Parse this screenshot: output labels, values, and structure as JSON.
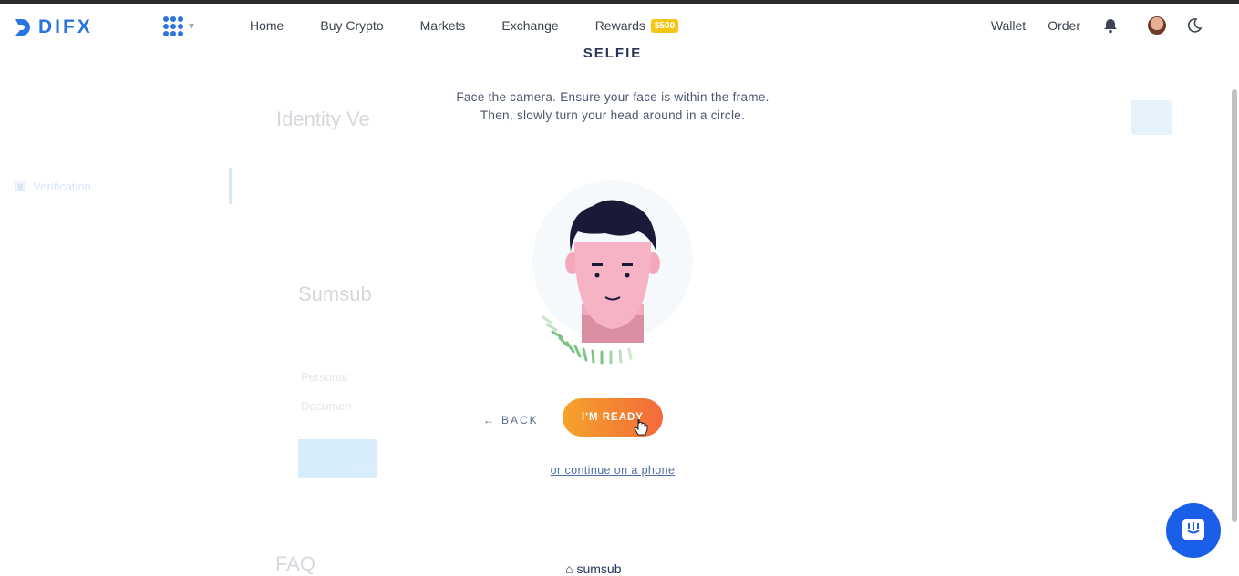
{
  "brand": {
    "name": "DIFX",
    "accent": "#2a74e0"
  },
  "nav": {
    "links": [
      "Home",
      "Buy Crypto",
      "Markets",
      "Exchange",
      "Rewards"
    ],
    "rewards_badge": "$500",
    "wallet": "Wallet",
    "order": "Order"
  },
  "background": {
    "title": "Identity Ve",
    "sidebar_item": "Verification",
    "provider": "Sumsub",
    "row1": "Personal",
    "row2": "Documen",
    "faq": "FAQ"
  },
  "modal": {
    "title": "SELFIE",
    "instruction_line1": "Face the camera. Ensure your face is within the frame.",
    "instruction_line2": "Then, slowly turn your head around in a circle.",
    "back_label": "BACK",
    "ready_label": "I'M READY",
    "phone_link": "or continue on a phone",
    "powered_by": "sumsub"
  },
  "icons": [
    "apps-grid-icon",
    "bell-icon",
    "moon-icon",
    "back-arrow-icon",
    "chat-icon",
    "pointer-cursor-icon"
  ],
  "colors": {
    "ready_start": "#f5a32a",
    "ready_end": "#f36a3a",
    "chat": "#1a5fe8",
    "title": "#26345c"
  }
}
